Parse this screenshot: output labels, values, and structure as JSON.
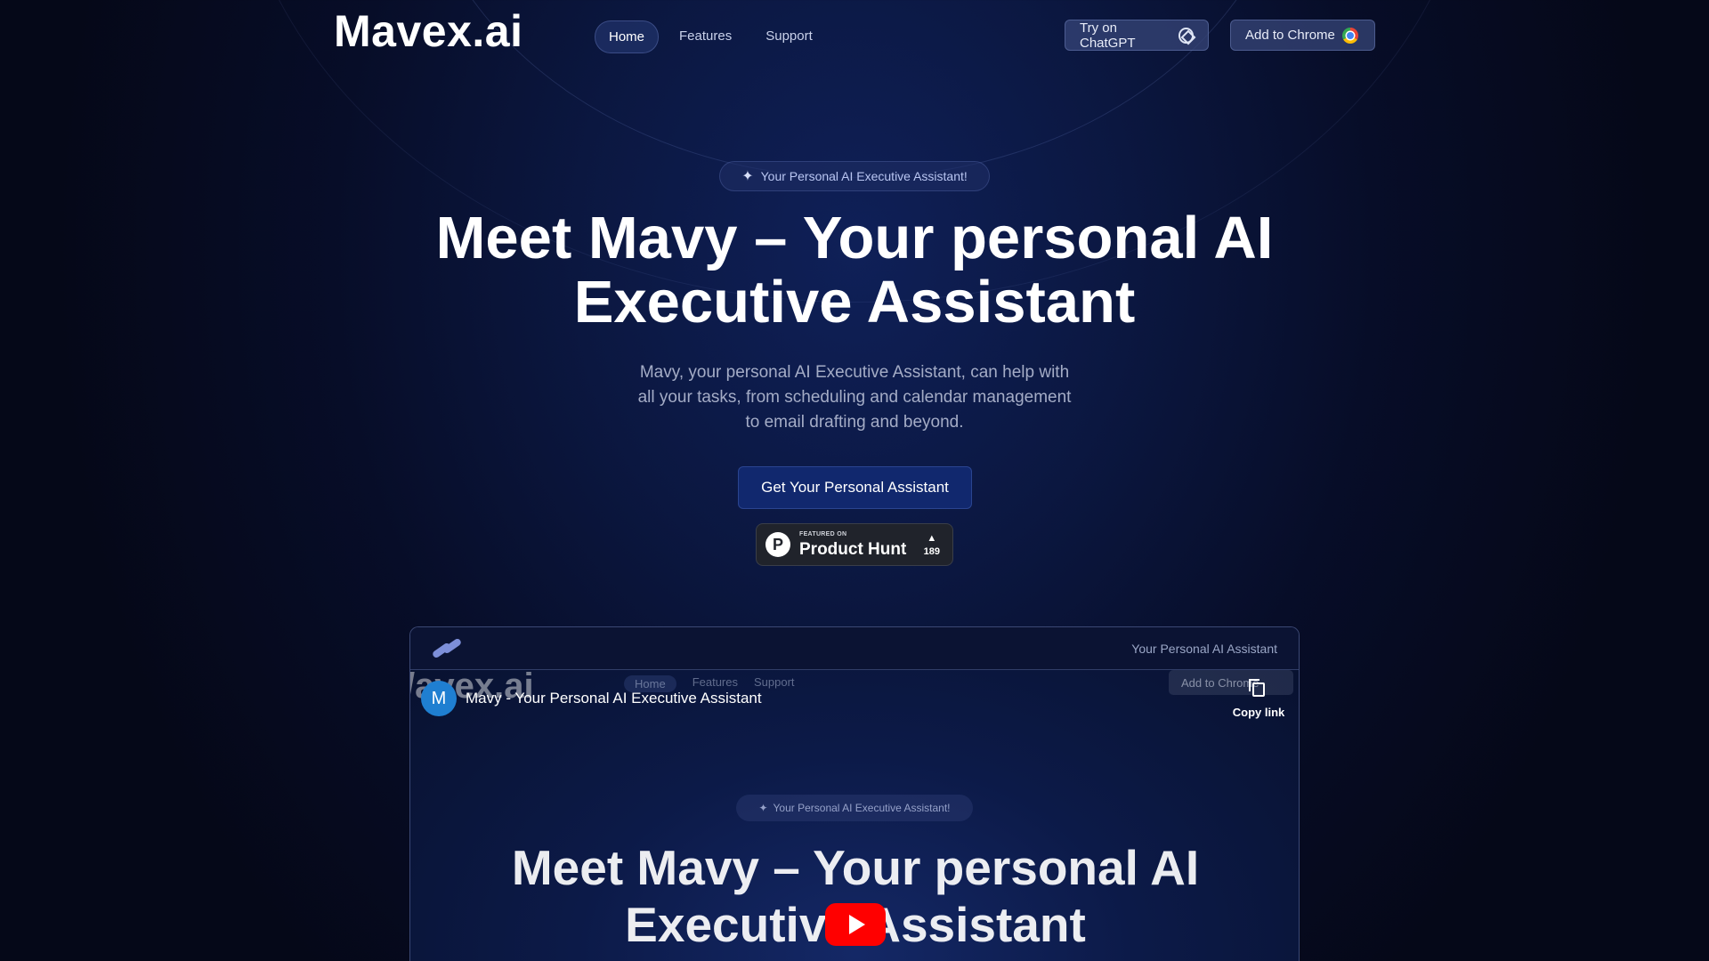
{
  "brand": {
    "logo": "Mavex.ai"
  },
  "nav": {
    "items": [
      {
        "label": "Home",
        "active": true
      },
      {
        "label": "Features",
        "active": false
      },
      {
        "label": "Support",
        "active": false
      }
    ],
    "try_chatgpt": "Try on ChatGPT",
    "add_chrome": "Add to Chrome"
  },
  "hero": {
    "badge": "Your Personal AI Executive Assistant!",
    "title_line1": "Meet Mavy – Your personal AI",
    "title_line2": "Executive Assistant",
    "subtitle_line1": "Mavy, your personal AI Executive Assistant, can help with",
    "subtitle_line2": "all your tasks, from scheduling and calendar management",
    "subtitle_line3": "to email drafting and beyond.",
    "cta": "Get Your Personal Assistant"
  },
  "product_hunt": {
    "featured": "FEATURED ON",
    "name": "Product Hunt",
    "votes": "189",
    "logo_letter": "P"
  },
  "panel": {
    "header_text": "Your Personal AI Assistant",
    "video": {
      "channel_initial": "M",
      "title": "Mavy - Your Personal AI Executive Assistant",
      "copy_link": "Copy link",
      "ghost_logo": "/avex.ai",
      "ghost_nav": [
        "Home",
        "Features",
        "Support"
      ],
      "ghost_chrome": "Add to Chrome",
      "badge": "Your Personal AI Executive Assistant!",
      "hero_line1": "Meet Mavy – Your personal AI",
      "hero_line2": "Executive Assistant"
    }
  },
  "colors": {
    "background": "#070d28",
    "cta": "#11286e",
    "youtube": "#ff0000"
  }
}
